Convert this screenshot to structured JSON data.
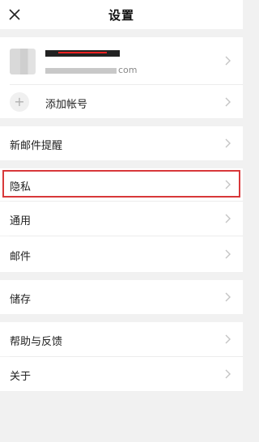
{
  "header": {
    "title": "设置",
    "close_icon": "close-icon"
  },
  "account": {
    "email_suffix": "com",
    "add_account_label": "添加帐号"
  },
  "menu": {
    "new_mail_reminder": "新邮件提醒",
    "privacy": "隐私",
    "general": "通用",
    "mail": "邮件",
    "storage": "储存",
    "help_feedback": "帮助与反馈",
    "about": "关于"
  },
  "colors": {
    "highlight": "#d8383a",
    "background": "#f1f1f1",
    "chevron": "#c4c4c4"
  }
}
